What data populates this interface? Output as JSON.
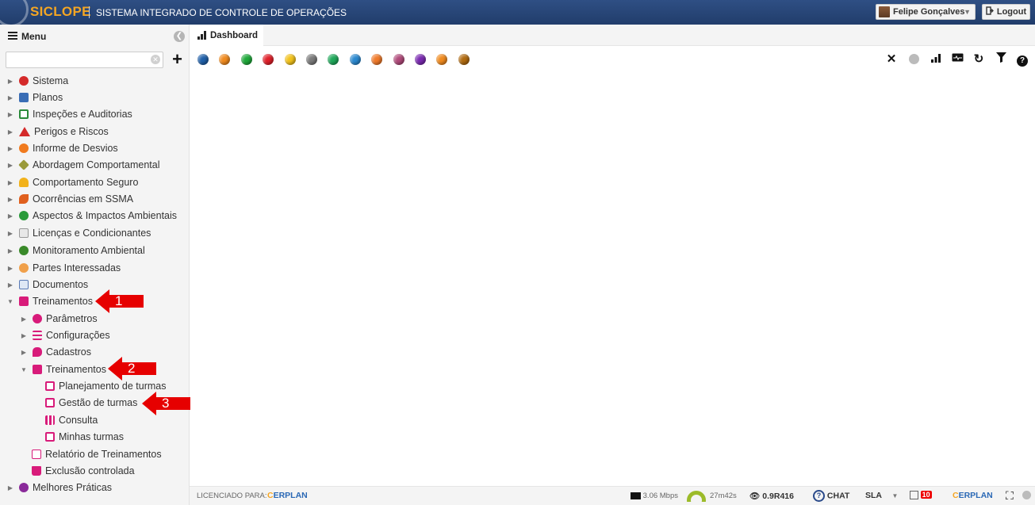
{
  "header": {
    "brand": "SICLOPE",
    "title": "SISTEMA INTEGRADO DE CONTROLE DE OPERAÇÕES",
    "user_name": "Felipe Gonçalves",
    "logout_label": "Logout"
  },
  "sidebar": {
    "menu_label": "Menu",
    "search_value": "",
    "items": [
      {
        "label": "Sistema",
        "icon": "gear-icon"
      },
      {
        "label": "Planos",
        "icon": "plan-icon"
      },
      {
        "label": "Inspeções e Auditorias",
        "icon": "clipboard-check-icon"
      },
      {
        "label": "Perigos e Riscos",
        "icon": "warning-icon"
      },
      {
        "label": "Informe de Desvios",
        "icon": "chat-icon"
      },
      {
        "label": "Abordagem Comportamental",
        "icon": "diamond-icon"
      },
      {
        "label": "Comportamento Seguro",
        "icon": "helmet-icon"
      },
      {
        "label": "Ocorrências em SSMA",
        "icon": "fall-icon"
      },
      {
        "label": "Aspectos & Impactos Ambientais",
        "icon": "recycle-icon"
      },
      {
        "label": "Licenças e Condicionantes",
        "icon": "document-icon"
      },
      {
        "label": "Monitoramento Ambiental",
        "icon": "tree-icon"
      },
      {
        "label": "Partes Interessadas",
        "icon": "people-icon"
      },
      {
        "label": "Documentos",
        "icon": "docs-icon"
      },
      {
        "label": "Treinamentos",
        "icon": "folder-open-icon"
      }
    ],
    "training_children": [
      {
        "label": "Parâmetros",
        "icon": "gear-icon"
      },
      {
        "label": "Configurações",
        "icon": "sliders-icon"
      },
      {
        "label": "Cadastros",
        "icon": "comment-icon"
      },
      {
        "label": "Treinamentos",
        "icon": "folder-open-icon"
      }
    ],
    "training_sub_children": [
      {
        "label": "Planejamento de turmas",
        "icon": "calendar-icon"
      },
      {
        "label": "Gestão de turmas",
        "icon": "calendar-icon"
      },
      {
        "label": "Consulta",
        "icon": "grid-icon"
      },
      {
        "label": "Minhas turmas",
        "icon": "calendar-icon"
      }
    ],
    "training_leaves": [
      {
        "label": "Relatório de Treinamentos",
        "icon": "pdf-icon"
      },
      {
        "label": "Exclusão controlada",
        "icon": "trash-icon"
      }
    ],
    "last_item": {
      "label": "Melhores Práticas",
      "icon": "award-icon"
    }
  },
  "annotations": [
    "1",
    "2",
    "3"
  ],
  "tabs": [
    {
      "label": "Dashboard",
      "icon": "bar-chart-icon"
    }
  ],
  "filter_dot_colors": [
    "#1f5fa8",
    "#f08a1e",
    "#1fa83a",
    "#e0202a",
    "#f2c21b",
    "#7a7a7a",
    "#1fa85a",
    "#2a88cf",
    "#f07a2a",
    "#b04a7a",
    "#7a2ab0",
    "#f08a1e",
    "#b06a10"
  ],
  "toolbar_icons": [
    "close-icon",
    "status-dot-icon",
    "signal-icon",
    "monitor-icon",
    "refresh-icon",
    "filter-icon",
    "help-icon"
  ],
  "status": {
    "licensed_label": "LICENCIADO PARA:",
    "licensee_prefix": "C",
    "licensee_name": "ERPLAN",
    "speed": "3.06 Mbps",
    "timer": "27m42s",
    "version": "0.9R416",
    "chat_label": "CHAT",
    "sla_label": "SLA",
    "notification_count": "10",
    "brand_prefix": "C",
    "brand_name": "ERPLAN"
  }
}
